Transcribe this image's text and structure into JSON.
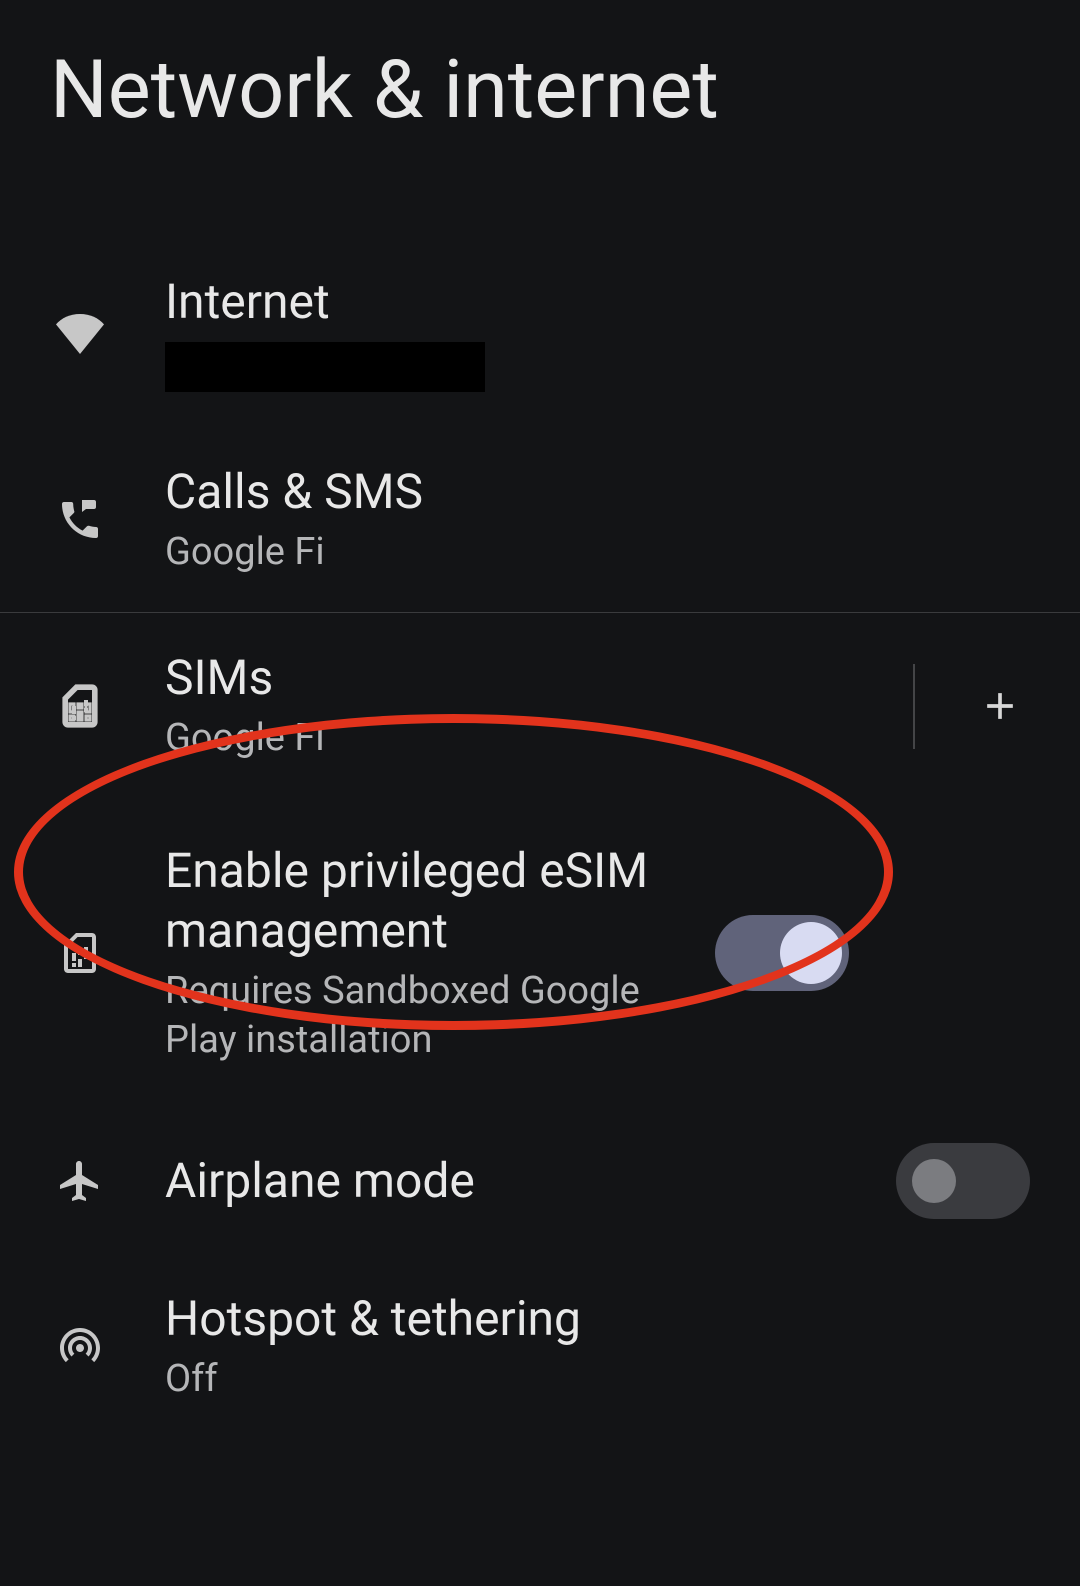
{
  "page": {
    "title": "Network & internet"
  },
  "items": {
    "internet": {
      "title": "Internet"
    },
    "calls_sms": {
      "title": "Calls & SMS",
      "subtitle": "Google Fi"
    },
    "sims": {
      "title": "SIMs",
      "subtitle": "Google Fi"
    },
    "esim": {
      "title": "Enable privileged eSIM management",
      "subtitle": "Requires Sandboxed Google Play installation",
      "enabled": true
    },
    "airplane": {
      "title": "Airplane mode",
      "enabled": false
    },
    "hotspot": {
      "title": "Hotspot & tethering",
      "subtitle": "Off"
    }
  }
}
